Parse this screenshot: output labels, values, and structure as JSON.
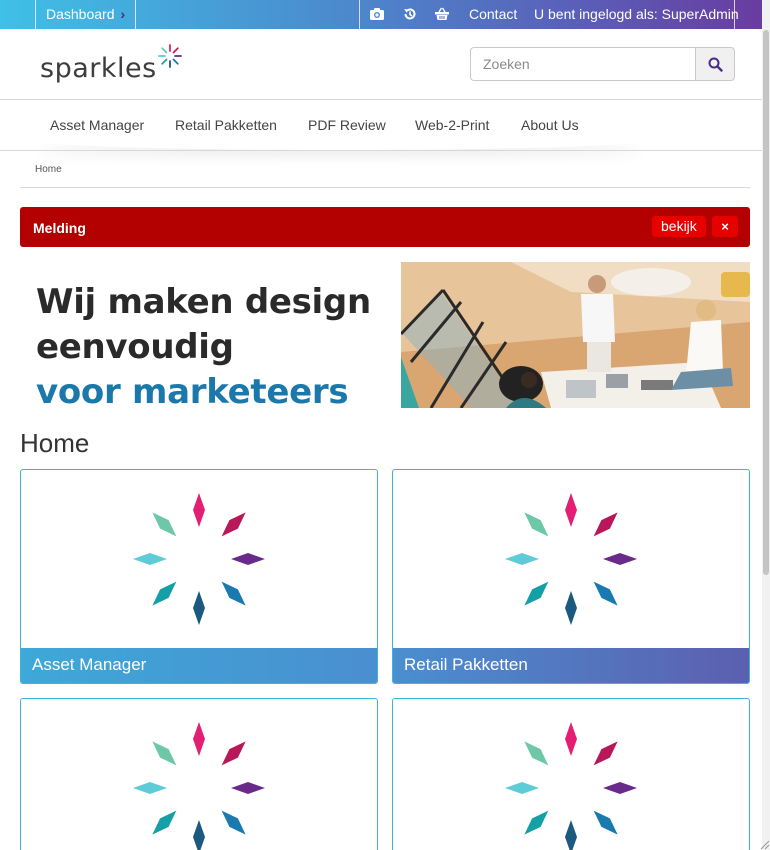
{
  "topbar": {
    "dashboard_label": "Dashboard",
    "chevron": "›",
    "icons": [
      "camera-icon",
      "history-icon",
      "basket-icon"
    ],
    "contact_label": "Contact",
    "logged_in_label": "U bent ingelogd als: SuperAdmin"
  },
  "header": {
    "logo_text": "sparkles",
    "search_placeholder": "Zoeken"
  },
  "nav": {
    "items": [
      "Asset Manager",
      "Retail Pakketten",
      "PDF Review",
      "Web-2-Print",
      "About Us"
    ]
  },
  "breadcrumb": {
    "home": "Home"
  },
  "alert": {
    "title": "Melding",
    "view_label": "bekijk",
    "close_label": "×"
  },
  "hero": {
    "line1": "Wij maken design",
    "line2": "eenvoudig",
    "line3": "voor marketeers"
  },
  "page": {
    "heading": "Home"
  },
  "tiles": [
    {
      "label": "Asset Manager"
    },
    {
      "label": "Retail Pakketten"
    },
    {
      "label": ""
    },
    {
      "label": ""
    }
  ],
  "colors": {
    "brand_blue": "#1a78aa",
    "alert_red": "#b30000",
    "alert_button_red": "#e60000",
    "tile_border": "#3bb6d9"
  }
}
